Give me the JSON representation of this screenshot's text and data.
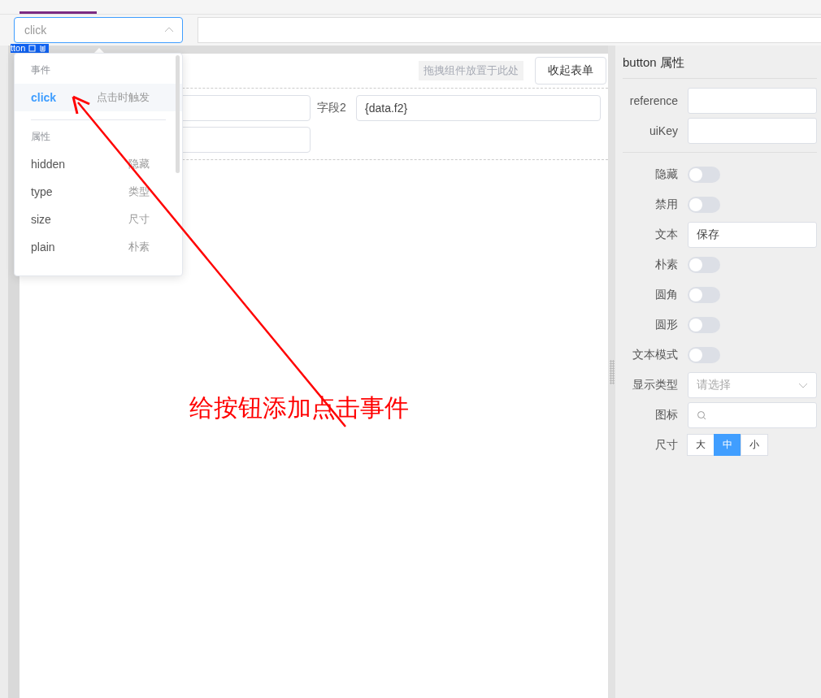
{
  "selector": {
    "placeholder": "click",
    "expanded": true
  },
  "selected_component": {
    "label": "tton"
  },
  "dropdown": {
    "sections": [
      {
        "heading": "事件",
        "items": [
          {
            "name": "click",
            "desc": "点击时触发",
            "selected": true
          }
        ]
      },
      {
        "heading": "属性",
        "items": [
          {
            "name": "hidden",
            "desc": "隐藏",
            "selected": false
          },
          {
            "name": "type",
            "desc": "类型",
            "selected": false
          },
          {
            "name": "size",
            "desc": "尺寸",
            "selected": false
          },
          {
            "name": "plain",
            "desc": "朴素",
            "selected": false
          }
        ]
      }
    ]
  },
  "canvas": {
    "drop_hint": "拖拽组件放置于此处",
    "collapse_button": "收起表单",
    "field": {
      "label": "字段2",
      "value": "{data.f2}"
    }
  },
  "annotation": {
    "text": "给按钮添加点击事件"
  },
  "properties": {
    "title": "button 属性",
    "groups": [
      [
        {
          "kind": "input",
          "label": "reference"
        },
        {
          "kind": "input",
          "label": "uiKey"
        }
      ],
      [
        {
          "kind": "switch",
          "label": "隐藏",
          "on": false
        },
        {
          "kind": "switch",
          "label": "禁用",
          "on": false
        },
        {
          "kind": "input",
          "label": "文本",
          "value": "保存"
        },
        {
          "kind": "switch",
          "label": "朴素",
          "on": false
        },
        {
          "kind": "switch",
          "label": "圆角",
          "on": false
        },
        {
          "kind": "switch",
          "label": "圆形",
          "on": false
        },
        {
          "kind": "switch",
          "label": "文本模式",
          "on": false
        },
        {
          "kind": "select",
          "label": "显示类型",
          "placeholder": "请选择"
        },
        {
          "kind": "search",
          "label": "图标"
        },
        {
          "kind": "segmented",
          "label": "尺寸",
          "options": [
            {
              "label": "大",
              "selected": false
            },
            {
              "label": "中",
              "selected": true
            },
            {
              "label": "小",
              "selected": false
            }
          ]
        }
      ]
    ]
  }
}
